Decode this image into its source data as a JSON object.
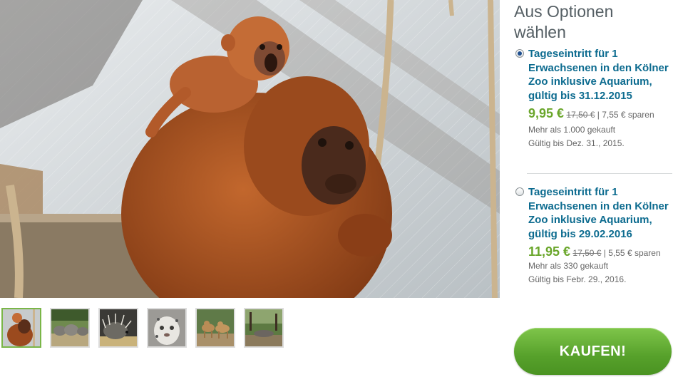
{
  "hero_image": {
    "subject": "Brüllaffen-Mutter mit Jungtier im Kölner Zoo"
  },
  "thumbnails": [
    {
      "subject": "howler-monkeys",
      "active": true
    },
    {
      "subject": "elephants",
      "active": false
    },
    {
      "subject": "porcupine",
      "active": false
    },
    {
      "subject": "snow-leopard",
      "active": false
    },
    {
      "subject": "camels",
      "active": false
    },
    {
      "subject": "zoo-enclosure",
      "active": false
    }
  ],
  "panel": {
    "title": "Aus Optionen wählen",
    "options": [
      {
        "selected": true,
        "title": "Tageseintritt für 1 Erwachsenen in den Kölner Zoo inklusive Aquarium, gültig bis 31.12.2015",
        "price": "9,95 €",
        "old_price": "17,50 €",
        "separator": " | ",
        "savings": "7,55 € sparen",
        "sold": "Mehr als 1.000 gekauft",
        "valid": "Gültig bis Dez. 31., 2015."
      },
      {
        "selected": false,
        "title": "Tageseintritt für 1 Erwachsenen in den Kölner Zoo inklusive Aquarium, gültig bis 29.02.2016",
        "price": "11,95 €",
        "old_price": "17,50 €",
        "separator": " | ",
        "savings": "5,55 € sparen",
        "sold": "Mehr als 330 gekauft",
        "valid": "Gültig bis Febr. 29., 2016."
      }
    ],
    "buy_label": "KAUFEN!"
  },
  "colors": {
    "accent_green": "#6aa62b",
    "title_blue": "#0c6b8f",
    "button_green": "#57a12b"
  }
}
